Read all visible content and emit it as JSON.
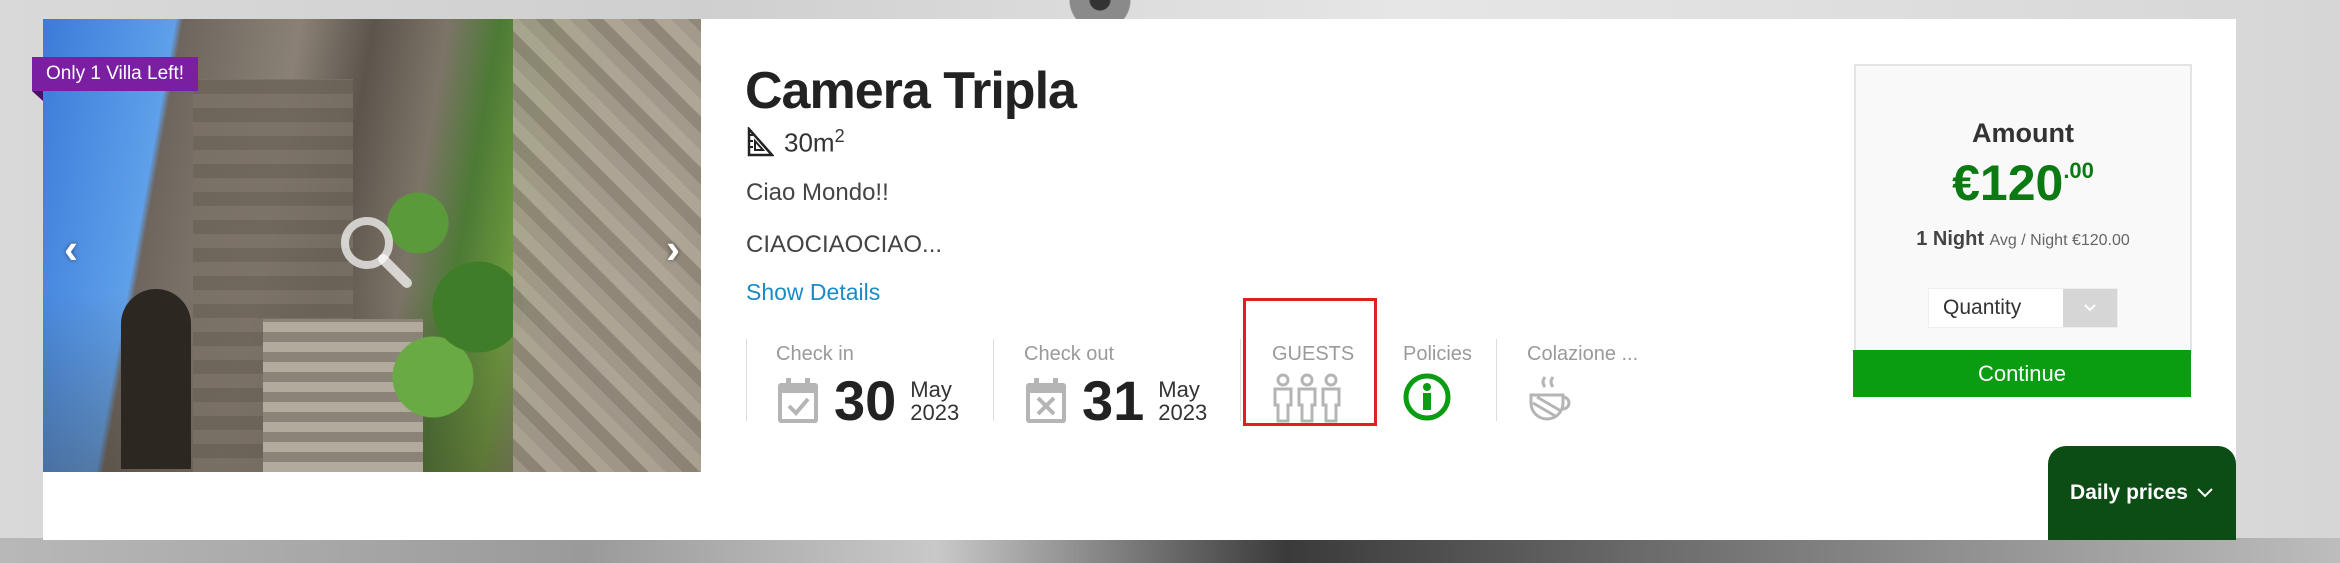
{
  "room": {
    "badge": "Only 1 Villa Left!",
    "title": "Camera Tripla",
    "size_value": "30m",
    "size_sup": "2",
    "description_line1": "Ciao Mondo!!",
    "description_line2": "CIAOCIAOCIAO...",
    "show_details": "Show Details"
  },
  "gallery": {
    "prev_glyph": "‹",
    "next_glyph": "›"
  },
  "info": {
    "checkin_label": "Check in",
    "checkin_day": "30",
    "checkin_month": "May",
    "checkin_year": "2023",
    "checkout_label": "Check out",
    "checkout_day": "31",
    "checkout_month": "May",
    "checkout_year": "2023",
    "guests_label": "GUESTS",
    "policies_label": "Policies",
    "breakfast_label": "Colazione ..."
  },
  "price": {
    "amount_label": "Amount",
    "amount_main": "€120",
    "amount_cents": ".00",
    "nights": "1 Night",
    "avg": "Avg / Night €120.00",
    "quantity_label": "Quantity",
    "continue_label": "Continue",
    "daily_prices_label": "Daily prices"
  },
  "colors": {
    "badge": "#7b1fa2",
    "price_green": "#0b7a13",
    "continue_green": "#0a9d12",
    "daily_green": "#0b4d14",
    "link_blue": "#1a8bc7",
    "highlight_red": "#e02020"
  }
}
